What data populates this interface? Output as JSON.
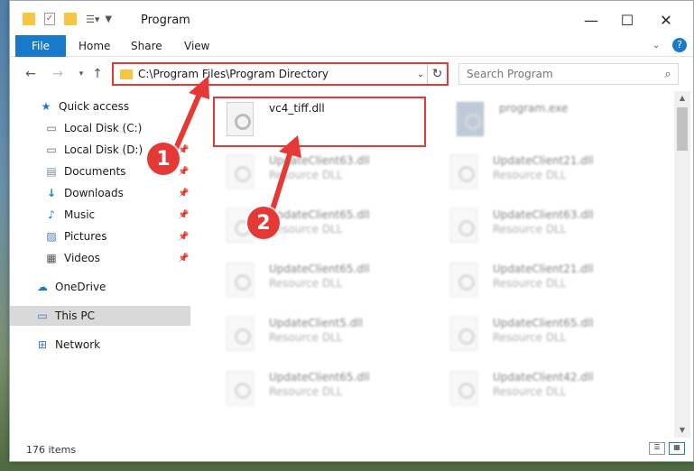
{
  "window": {
    "title": "Program"
  },
  "ribbon": {
    "file": "File",
    "home": "Home",
    "share": "Share",
    "view": "View"
  },
  "address": {
    "path": "C:\\Program Files\\Program Directory"
  },
  "search": {
    "placeholder": "Search Program"
  },
  "sidebar": {
    "items": [
      {
        "label": "Quick access",
        "icon": "star-icon"
      },
      {
        "label": "Local Disk (C:)",
        "icon": "drive-icon"
      },
      {
        "label": "Local Disk (D:)",
        "icon": "drive-icon"
      },
      {
        "label": "Documents",
        "icon": "documents-icon"
      },
      {
        "label": "Downloads",
        "icon": "download-icon"
      },
      {
        "label": "Music",
        "icon": "music-icon"
      },
      {
        "label": "Pictures",
        "icon": "pictures-icon"
      },
      {
        "label": "Videos",
        "icon": "videos-icon"
      },
      {
        "label": "OneDrive",
        "icon": "cloud-icon"
      },
      {
        "label": "This PC",
        "icon": "computer-icon"
      },
      {
        "label": "Network",
        "icon": "network-icon"
      }
    ]
  },
  "files": {
    "highlighted": {
      "name": "vc4_tiff.dll"
    },
    "program": {
      "name": "program.exe"
    },
    "list": [
      {
        "name": "UpdateClient63.dll",
        "type": "Resource DLL"
      },
      {
        "name": "UpdateClient21.dll",
        "type": "Resource DLL"
      },
      {
        "name": "UpdateClient65.dll",
        "type": "Resource DLL"
      },
      {
        "name": "UpdateClient63.dll",
        "type": "Resource DLL"
      },
      {
        "name": "UpdateClient65.dll",
        "type": "Resource DLL"
      },
      {
        "name": "UpdateClient21.dll",
        "type": "Resource DLL"
      },
      {
        "name": "UpdateClient5.dll",
        "type": "Resource DLL"
      },
      {
        "name": "UpdateClient65.dll",
        "type": "Resource DLL"
      },
      {
        "name": "UpdateClient65.dll",
        "type": "Resource DLL"
      },
      {
        "name": "UpdateClient42.dll",
        "type": "Resource DLL"
      }
    ]
  },
  "status": {
    "count": "176 items"
  },
  "annotations": {
    "step1": "1",
    "step2": "2",
    "color": "#e53935"
  }
}
